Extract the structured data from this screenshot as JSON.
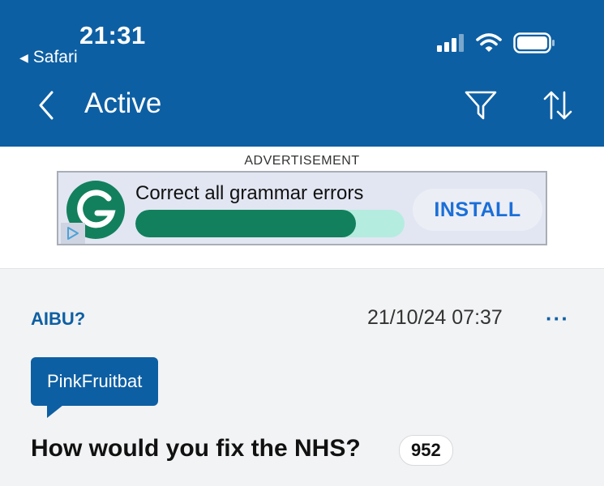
{
  "status_bar": {
    "time": "21:31",
    "back_app": "Safari",
    "icons": [
      "signal-icon",
      "wifi-icon",
      "battery-icon"
    ]
  },
  "nav": {
    "back_icon": "chevron-left-icon",
    "title": "Active",
    "filter_icon": "filter-icon",
    "sort_icon": "sort-icon"
  },
  "ad": {
    "label": "ADVERTISEMENT",
    "text": "Correct all grammar errors",
    "button": "INSTALL",
    "progress": 0.82,
    "logo_letter": "G"
  },
  "thread": {
    "topic": "AIBU?",
    "date": "21/10/24 07:37",
    "more": "···",
    "author": "PinkFruitbat",
    "title": "How would you fix the NHS?",
    "reply_count": "952"
  },
  "colors": {
    "brand": "#0d5fa3",
    "ad_green": "#12805c",
    "ad_progress_bg": "#b5ece0",
    "install_text": "#1a6fd8"
  }
}
